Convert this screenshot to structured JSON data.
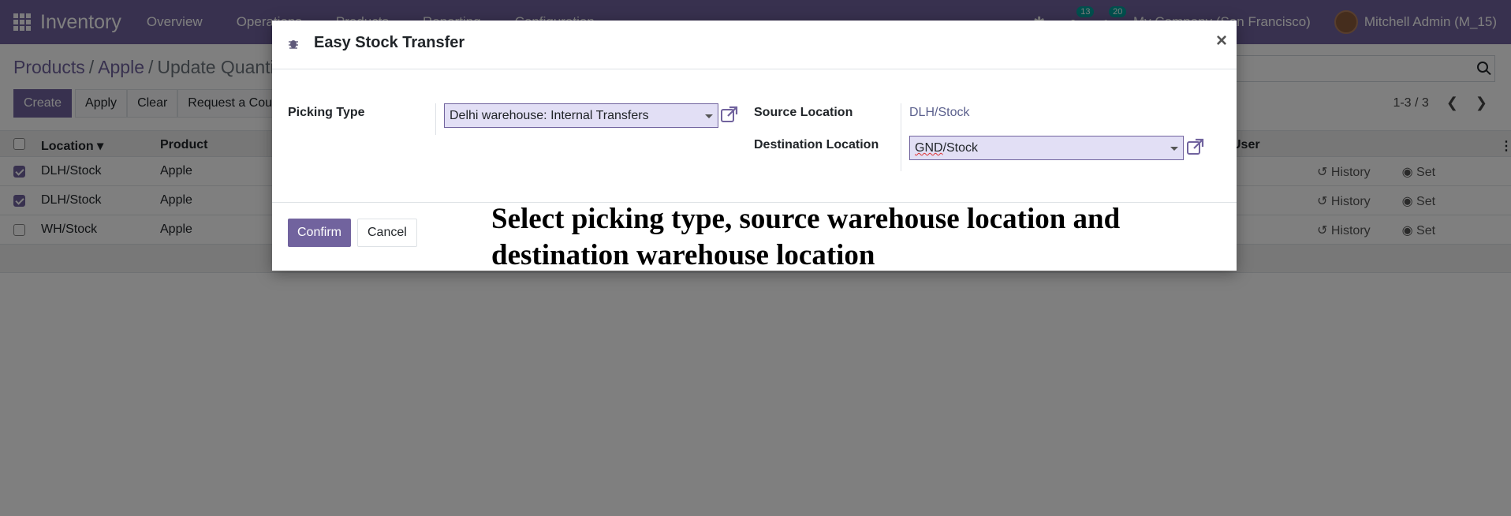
{
  "navbar": {
    "app_name": "Inventory",
    "menu": [
      "Overview",
      "Operations",
      "Products",
      "Reporting",
      "Configuration"
    ],
    "badges": [
      "13",
      "20"
    ],
    "company": "My Company (San Francisco)",
    "user": "Mitchell Admin (M_15)"
  },
  "breadcrumb": {
    "first": "Products",
    "second": "Apple",
    "current": "Update Quantity"
  },
  "toolbar": {
    "create": "Create",
    "apply": "Apply",
    "clear": "Clear",
    "request": "Request a Count"
  },
  "pager": {
    "value": "1-3 / 3"
  },
  "list": {
    "headers": {
      "location": "Location",
      "product": "Product",
      "user": "User"
    },
    "rows": [
      {
        "location": "DLH/Stock",
        "product": "Apple",
        "checked": true
      },
      {
        "location": "DLH/Stock",
        "product": "Apple",
        "checked": true
      },
      {
        "location": "WH/Stock",
        "product": "Apple",
        "checked": false
      }
    ],
    "history_label": "History",
    "set_label": "Set"
  },
  "modal": {
    "title": "Easy Stock Transfer",
    "close": "×",
    "picking_type_label": "Picking Type",
    "picking_type_value": "Delhi warehouse: Internal Transfers",
    "source_location_label": "Source Location",
    "source_location_value": "DLH/Stock",
    "destination_location_label": "Destination Location",
    "destination_prefix": "GND",
    "destination_suffix": "/Stock",
    "confirm": "Confirm",
    "cancel": "Cancel"
  },
  "annotation": "Select picking type, source warehouse location and destination warehouse location",
  "colors": {
    "brand": "#71639e",
    "badge": "#00a09d",
    "select_bg": "#e2dff5"
  },
  "icons": [
    "apps-grid-icon",
    "bug-icon",
    "chat-icon",
    "clock-icon",
    "search-icon",
    "external-link-icon",
    "history-icon",
    "set-icon",
    "close-icon"
  ]
}
